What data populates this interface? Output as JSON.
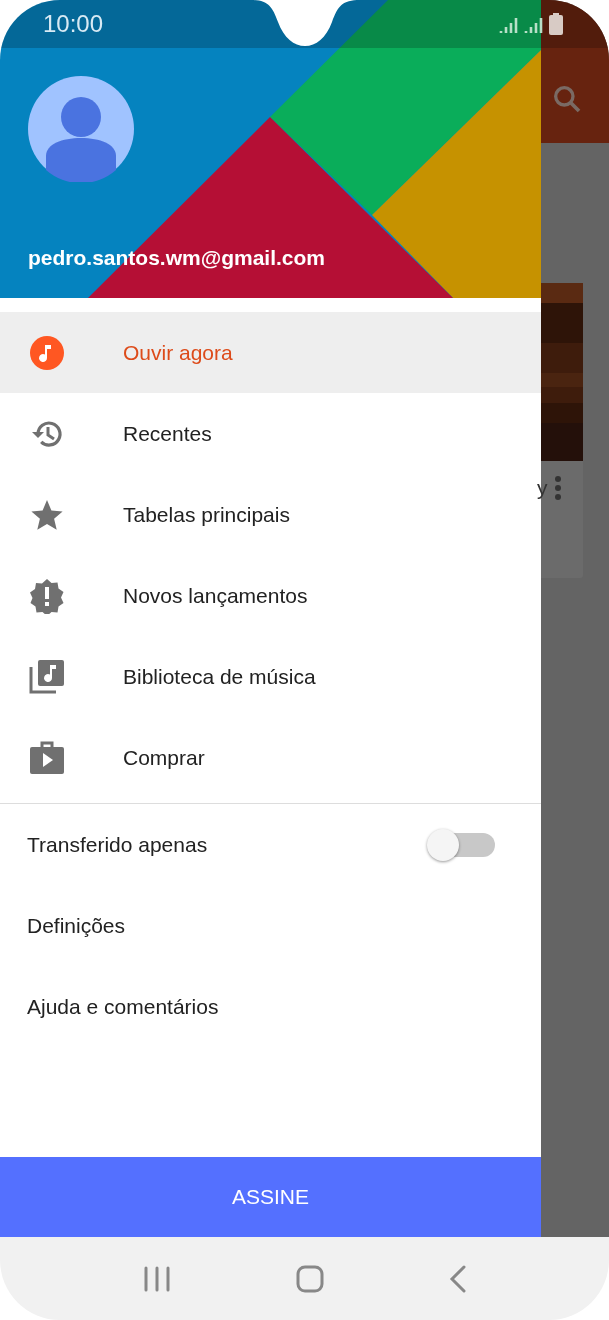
{
  "status_bar": {
    "time": "10:00"
  },
  "account": {
    "email": "pedro.santos.wm@gmail.com"
  },
  "menu": [
    {
      "label": "Ouvir agora",
      "selected": true
    },
    {
      "label": "Recentes",
      "selected": false
    },
    {
      "label": "Tabelas principais",
      "selected": false
    },
    {
      "label": "Novos lançamentos",
      "selected": false
    },
    {
      "label": "Biblioteca de música",
      "selected": false
    },
    {
      "label": "Comprar",
      "selected": false
    }
  ],
  "settings": [
    {
      "kind": "toggle",
      "label": "Transferido apenas",
      "on": false
    },
    {
      "kind": "link",
      "label": "Definições"
    },
    {
      "kind": "link",
      "label": "Ajuda e comentários"
    }
  ],
  "subscribe_button": "ASSINE",
  "background": {
    "card_title": "y"
  }
}
